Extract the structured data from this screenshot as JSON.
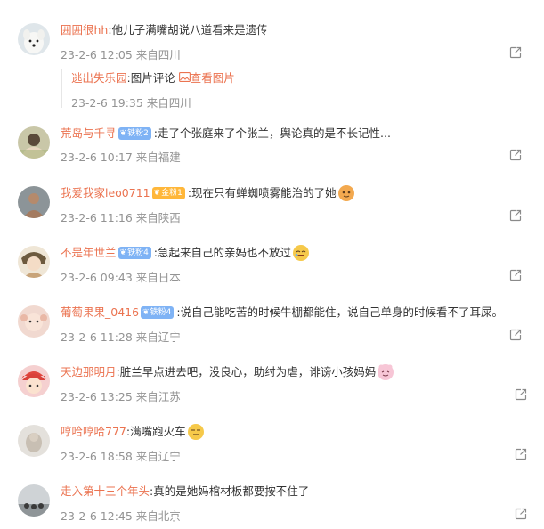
{
  "comments": [
    {
      "username": "囲囲很hh",
      "text": ":他儿子满嘴胡说八道看来是遗传",
      "meta": "23-2-6 12:05 来自四川",
      "reply": {
        "username": "逃出失乐园",
        "text": ":图片评论 ",
        "link": "查看图片",
        "meta": "23-2-6 19:35 来自四川"
      }
    },
    {
      "username": "荒岛与千寻",
      "badge": "铁粉2",
      "text": ":走了个张庭来了个张兰，舆论真的是不长记性...",
      "meta": "23-2-6 10:17 来自福建"
    },
    {
      "username": "我爱我家leo0711",
      "badge": "金粉1",
      "text": ":现在只有蝉蜘喷雾能治的了她",
      "meta": "23-2-6 11:16 来自陕西"
    },
    {
      "username": "不是年世兰",
      "badge": "铁粉4",
      "text": ":急起来自己的亲妈也不放过",
      "meta": "23-2-6 09:43 来自日本"
    },
    {
      "username": "葡萄果果_0416",
      "badge": "铁粉4",
      "text": ":说自己能吃苦的时候牛棚都能住，说自己单身的时候看不了耳屎。",
      "meta": "23-2-6 11:28 来自辽宁"
    },
    {
      "username": "天边那明月",
      "text": ":脏兰早点进去吧，没良心，助纣为虐，诽谤小孩妈妈",
      "meta": "23-2-6 13:25 来自江苏"
    },
    {
      "username": "哼哈哼哈777",
      "text": ":满嘴跑火车",
      "meta": "23-2-6 18:58 来自辽宁"
    },
    {
      "username": "走入第十三个年头",
      "text": ":真的是她妈棺材板都要按不住了",
      "meta": "23-2-6 12:45 来自北京"
    }
  ],
  "colors": {
    "username": "#eb7350",
    "meta": "#939393",
    "badge_orange": "#ffb73a",
    "badge_blue": "#7fb3f5"
  },
  "icons": {
    "share": "share-icon",
    "picture": "picture-icon"
  }
}
